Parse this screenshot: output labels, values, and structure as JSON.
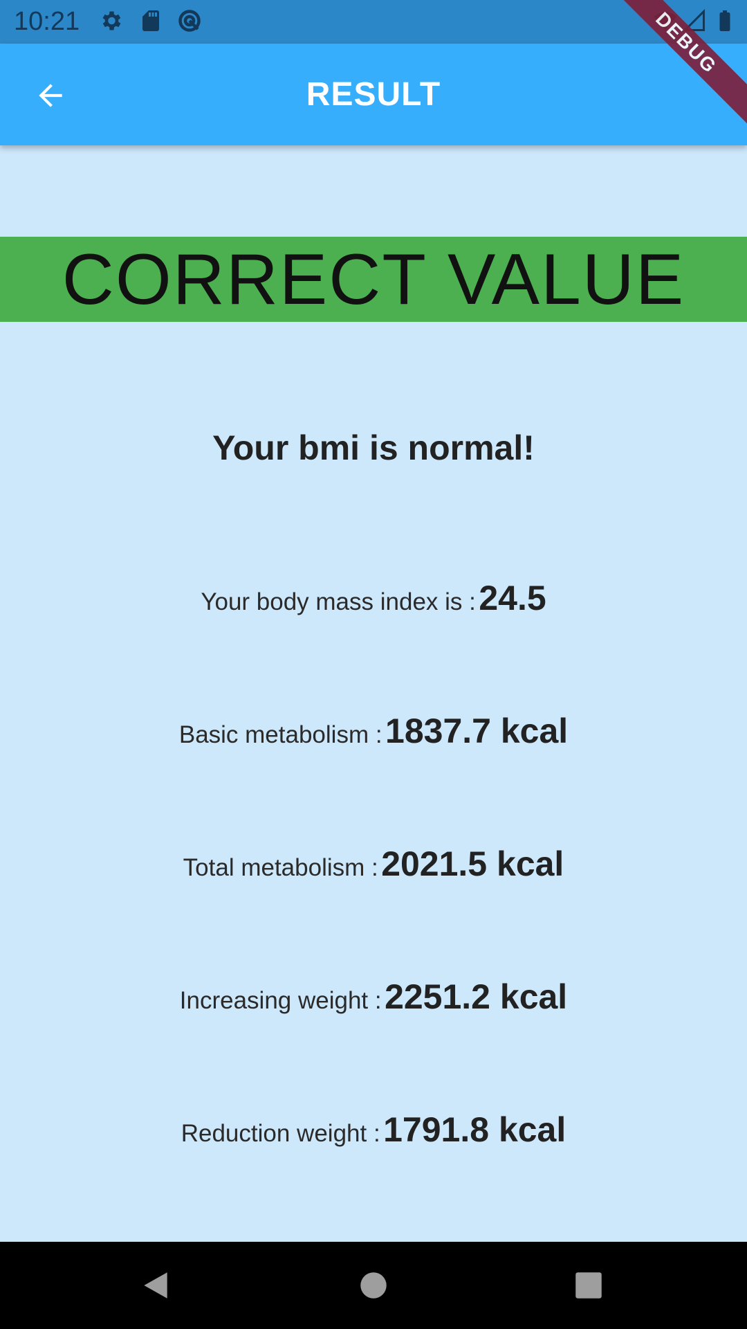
{
  "status_bar": {
    "time": "10:21",
    "left_icons": [
      "gear-icon",
      "sd-card-icon",
      "sync-icon"
    ],
    "right_icons": [
      "wifi-icon",
      "signal-icon",
      "battery-icon"
    ]
  },
  "app_bar": {
    "title": "RESULT",
    "back_icon": "arrow-back-icon",
    "color": "#36aefc"
  },
  "debug_banner": {
    "label": "DEBUG"
  },
  "result": {
    "banner_text": "CORRECT VALUE",
    "banner_color": "#4caf50",
    "message": "Your bmi is normal!"
  },
  "metrics": [
    {
      "label": "Your body mass index is :",
      "value": "24.5"
    },
    {
      "label": "Basic metabolism :",
      "value": "1837.7 kcal"
    },
    {
      "label": "Total metabolism :",
      "value": "2021.5 kcal"
    },
    {
      "label": "Increasing weight :",
      "value": "2251.2 kcal"
    },
    {
      "label": "Reduction weight :",
      "value": "1791.8 kcal"
    }
  ],
  "nav_bar": {
    "buttons": [
      "back-triangle-icon",
      "home-circle-icon",
      "recents-square-icon"
    ]
  }
}
